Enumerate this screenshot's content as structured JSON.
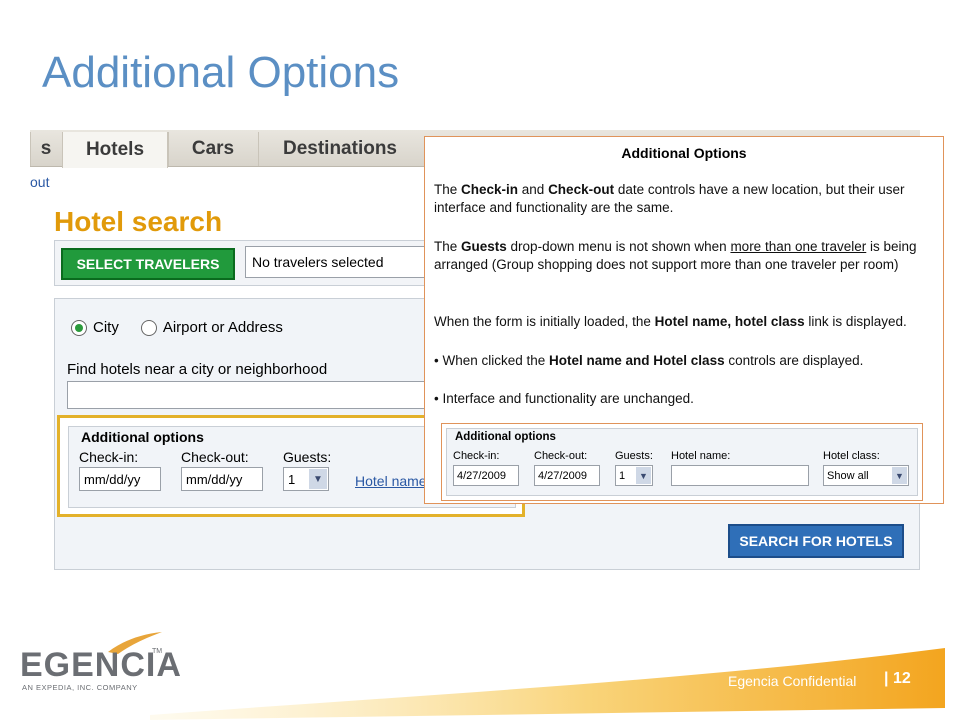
{
  "slide": {
    "title": "Additional Options"
  },
  "tabs": {
    "prev": "s",
    "hotels": "Hotels",
    "cars": "Cars",
    "destinations": "Destinations"
  },
  "header_link": "out",
  "hotel_search": {
    "title": "Hotel search",
    "select_travelers": "SELECT TRAVELERS",
    "travelers_value": "No travelers selected",
    "radio_city": "City",
    "radio_airport": "Airport or Address",
    "find_label": "Find hotels near a city or neighborhood",
    "search_button": "SEARCH FOR HOTELS"
  },
  "additional_options_form": {
    "legend": "Additional options",
    "checkin_label": "Check-in:",
    "checkout_label": "Check-out:",
    "guests_label": "Guests:",
    "checkin_value": "mm/dd/yy",
    "checkout_value": "mm/dd/yy",
    "guests_value": "1",
    "hotel_name_link": "Hotel name"
  },
  "callout": {
    "title": "Additional Options",
    "p1": [
      {
        "t": "The ",
        "s": ""
      },
      {
        "t": "Check-in",
        "s": "b"
      },
      {
        "t": " and ",
        "s": ""
      },
      {
        "t": "Check-out",
        "s": "b"
      },
      {
        "t": " date controls have a new location, but their user interface and functionality are the same.",
        "s": ""
      }
    ],
    "p2": [
      {
        "t": "The ",
        "s": ""
      },
      {
        "t": "Guests",
        "s": "b"
      },
      {
        "t": " drop-down menu is not shown when ",
        "s": ""
      },
      {
        "t": "more than one traveler",
        "s": "u"
      },
      {
        "t": " is being arranged (Group shopping does not support more than one traveler per room)",
        "s": ""
      }
    ],
    "p3": [
      {
        "t": "When the form is initially loaded, the ",
        "s": ""
      },
      {
        "t": "Hotel name, hotel class",
        "s": "b"
      },
      {
        "t": " link is displayed.",
        "s": ""
      }
    ],
    "bullet1": [
      {
        "t": "• When clicked the ",
        "s": ""
      },
      {
        "t": "Hotel name and Hotel class",
        "s": "b"
      },
      {
        "t": " controls are displayed.",
        "s": ""
      }
    ],
    "bullet2": [
      {
        "t": "• Interface and functionality are unchanged.",
        "s": ""
      }
    ],
    "mini_form": {
      "legend": "Additional options",
      "checkin_label": "Check-in:",
      "checkout_label": "Check-out:",
      "guests_label": "Guests:",
      "hotel_name_label": "Hotel name:",
      "hotel_class_label": "Hotel class:",
      "checkin_value": "4/27/2009",
      "checkout_value": "4/27/2009",
      "guests_value": "1",
      "hotel_name_value": "",
      "hotel_class_value": "Show all"
    }
  },
  "footer": {
    "logo_word": "EGENCIA",
    "logo_tm": "TM",
    "logo_sub": "AN EXPEDIA, INC. COMPANY",
    "confidential": "Egencia Confidential",
    "separator": "|",
    "page": "12"
  },
  "colors": {
    "title": "#5b8fc4",
    "accent_orange": "#f5a623",
    "hotel_title": "#e19a0a",
    "green_button": "#219a3c",
    "blue_button": "#2f6fb8"
  }
}
